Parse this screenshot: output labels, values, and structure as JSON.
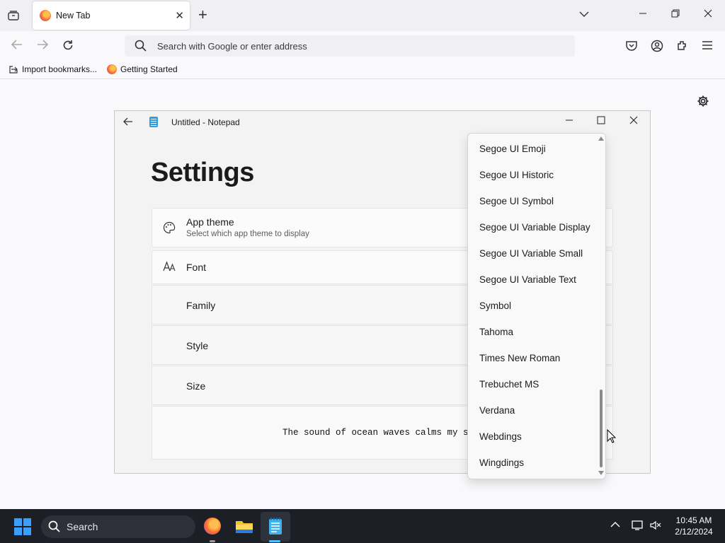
{
  "browser": {
    "tab_title": "New Tab",
    "address_placeholder": "Search with Google or enter address",
    "bookmarks": [
      {
        "label": "Import bookmarks..."
      },
      {
        "label": "Getting Started"
      }
    ]
  },
  "notepad": {
    "window_title": "Untitled - Notepad",
    "settings_heading": "Settings",
    "app_theme": {
      "label": "App theme",
      "description": "Select which app theme to display"
    },
    "font_section": {
      "label": "Font"
    },
    "font_rows": [
      {
        "label": "Family"
      },
      {
        "label": "Style"
      },
      {
        "label": "Size"
      }
    ],
    "preview_text": "The sound of ocean waves calms my so",
    "font_dropdown": {
      "items": [
        "Segoe UI Emoji",
        "Segoe UI Historic",
        "Segoe UI Symbol",
        "Segoe UI Variable Display",
        "Segoe UI Variable Small",
        "Segoe UI Variable Text",
        "Symbol",
        "Tahoma",
        "Times New Roman",
        "Trebuchet MS",
        "Verdana",
        "Webdings",
        "Wingdings"
      ]
    }
  },
  "taskbar": {
    "search_placeholder": "Search",
    "time": "10:45 AM",
    "date": "2/12/2024"
  },
  "colors": {
    "accent": "#3aa0ff",
    "taskbar_bg": "#1c1f26",
    "browser_chrome": "#f0f0f4"
  }
}
